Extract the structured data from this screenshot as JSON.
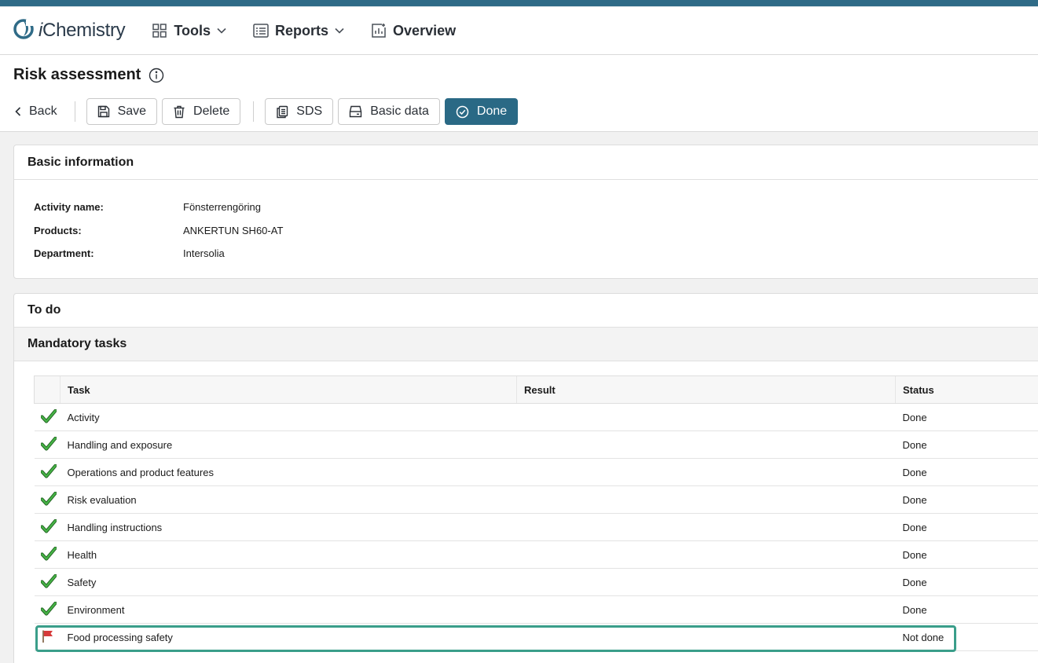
{
  "colors": {
    "accent": "#2a6985",
    "stripe": "#2f6b87",
    "check_green": "#2f9b2f",
    "flag_red": "#d63a3a",
    "highlight": "#3a9e8a"
  },
  "app": {
    "logo_i": "i",
    "logo_rest": "Chemistry"
  },
  "nav": [
    {
      "label": "Tools",
      "icon": "grid-icon",
      "has_dropdown": true
    },
    {
      "label": "Reports",
      "icon": "list-icon",
      "has_dropdown": true
    },
    {
      "label": "Overview",
      "icon": "chart-icon",
      "has_dropdown": false
    }
  ],
  "page": {
    "title": "Risk assessment"
  },
  "toolbar": {
    "back": "Back",
    "save": "Save",
    "delete": "Delete",
    "sds": "SDS",
    "basic_data": "Basic data",
    "done": "Done"
  },
  "basic_information": {
    "heading": "Basic information",
    "rows": [
      {
        "label": "Activity name:",
        "value": "Fönsterrengöring"
      },
      {
        "label": "Products:",
        "value": "ANKERTUN SH60-AT"
      },
      {
        "label": "Department:",
        "value": "Intersolia"
      }
    ]
  },
  "todo": {
    "heading": "To do",
    "mandatory_heading": "Mandatory tasks",
    "columns": [
      "Task",
      "Result",
      "Status"
    ],
    "tasks": [
      {
        "icon": "check-icon",
        "task": "Activity",
        "result": "",
        "status": "Done"
      },
      {
        "icon": "check-icon",
        "task": "Handling and exposure",
        "result": "",
        "status": "Done"
      },
      {
        "icon": "check-icon",
        "task": "Operations and product features",
        "result": "",
        "status": "Done"
      },
      {
        "icon": "check-icon",
        "task": "Risk evaluation",
        "result": "",
        "status": "Done"
      },
      {
        "icon": "check-icon",
        "task": "Handling instructions",
        "result": "",
        "status": "Done"
      },
      {
        "icon": "check-icon",
        "task": "Health",
        "result": "",
        "status": "Done"
      },
      {
        "icon": "check-icon",
        "task": "Safety",
        "result": "",
        "status": "Done"
      },
      {
        "icon": "check-icon",
        "task": "Environment",
        "result": "",
        "status": "Done"
      },
      {
        "icon": "flag-icon",
        "task": "Food processing safety",
        "result": "",
        "status": "Not done"
      }
    ]
  }
}
